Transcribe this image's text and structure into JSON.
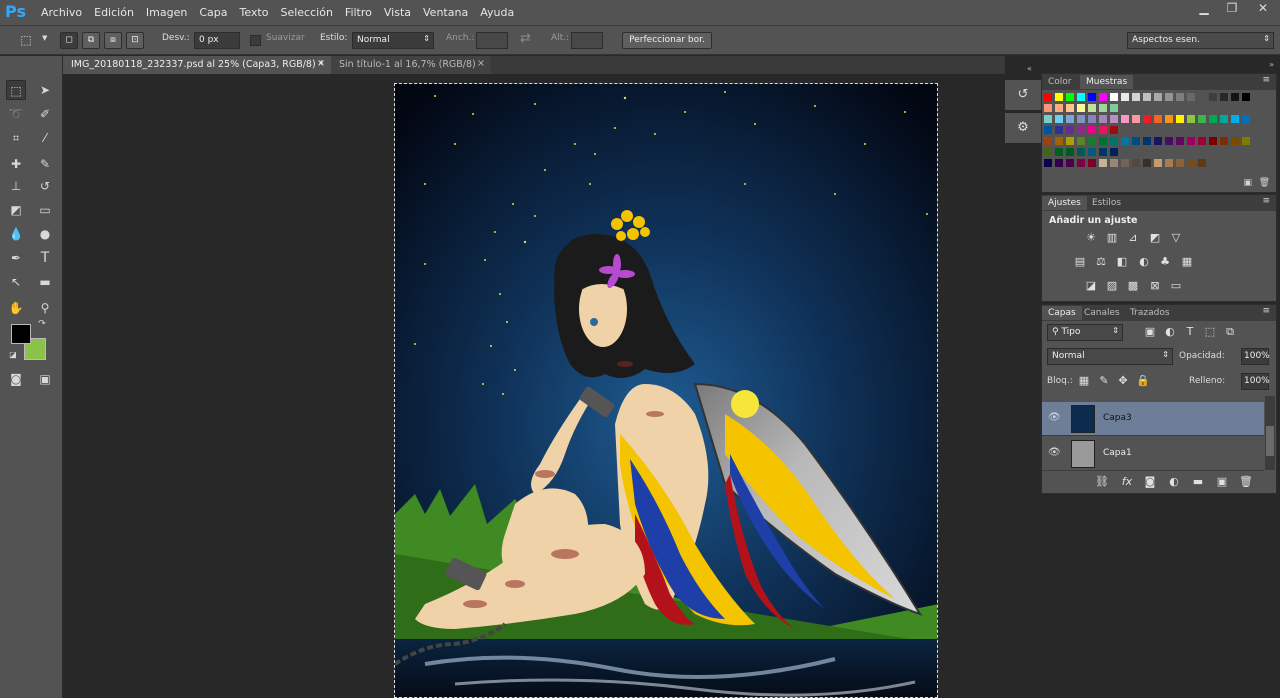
{
  "app": {
    "logo": "Ps"
  },
  "menu": [
    "Archivo",
    "Edición",
    "Imagen",
    "Capa",
    "Texto",
    "Selección",
    "Filtro",
    "Vista",
    "Ventana",
    "Ayuda"
  ],
  "window_controls": {
    "minimize": "▁",
    "restore": "❐",
    "close": "✕"
  },
  "options": {
    "feather_label": "Desv.:",
    "feather_value": "0 px",
    "antialias_label": "Suavizar",
    "style_label": "Estilo:",
    "style_value": "Normal",
    "width_label": "Anch.:",
    "height_label": "Alt.:",
    "refine_button": "Perfeccionar bor.",
    "workspace": "Aspectos esen."
  },
  "documents": [
    {
      "title": "IMG_20180118_232337.psd al 25% (Capa3, RGB/8) *",
      "active": true
    },
    {
      "title": "Sin título-1 al 16,7% (RGB/8)",
      "active": false
    }
  ],
  "tabs": {
    "close_glyph": "×"
  },
  "colors": {
    "foreground": "#000000",
    "background": "#8bc34a",
    "accent": "#31a8ff"
  },
  "swatches_panel": {
    "tabs": [
      "Color",
      "Muestras"
    ],
    "active": "Muestras"
  },
  "adjustments_panel": {
    "tabs": [
      "Ajustes",
      "Estilos"
    ],
    "active": "Ajustes",
    "heading": "Añadir un ajuste"
  },
  "layers_panel": {
    "tabs": [
      "Capas",
      "Canales",
      "Trazados"
    ],
    "active": "Capas",
    "filter_label": "Tipo",
    "blend_mode": "Normal",
    "opacity_label": "Opacidad:",
    "opacity_value": "100%",
    "lock_label": "Bloq.:",
    "fill_label": "Relleno:",
    "fill_value": "100%",
    "layers": [
      {
        "name": "Capa3",
        "selected": true,
        "visible": true
      },
      {
        "name": "Capa1",
        "selected": false,
        "visible": true
      }
    ]
  }
}
